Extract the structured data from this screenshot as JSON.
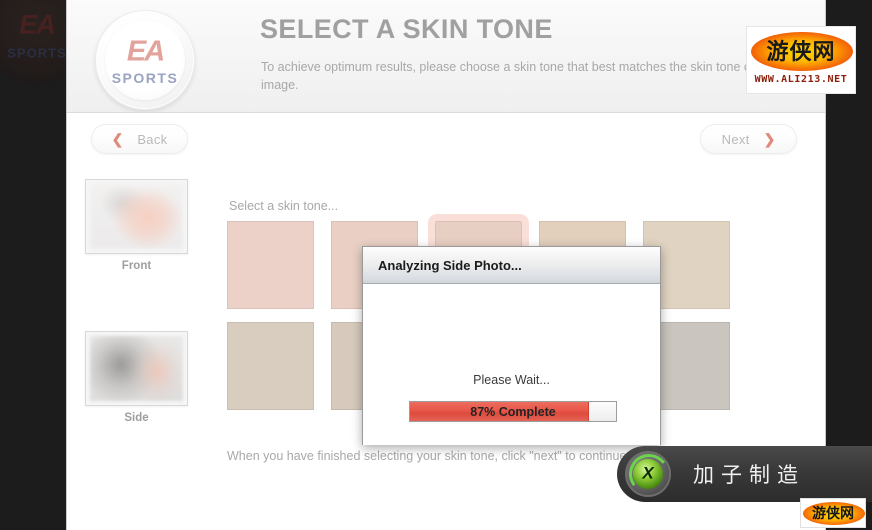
{
  "header": {
    "title": "SELECT A SKIN TONE",
    "subtitle": "To achieve optimum results, please choose a skin tone that best matches the skin tone of your image.",
    "logo": {
      "mark": "EA",
      "wordmark": "SPORTS"
    }
  },
  "nav": {
    "back_label": "Back",
    "back_chevron": "❮",
    "next_label": "Next",
    "next_chevron": "❯"
  },
  "thumbnails": [
    {
      "caption": "Front",
      "view": "front"
    },
    {
      "caption": "Side",
      "view": "side"
    }
  ],
  "swatches": {
    "instruction": "Select a skin tone...",
    "footer_note": "When you have finished selecting your skin tone, click \"next\" to continue.",
    "selected_index": 2,
    "selection_border_color": "#fadfd9",
    "rows": [
      [
        "#ecd1c9",
        "#ead0c4",
        "#e8cfc3",
        "#e2d0bd",
        "#e0d3c1"
      ],
      [
        "#d9cdc0",
        "#d7cabd",
        "#d2c8bd",
        "#ccc6c0",
        "#cac5be"
      ]
    ]
  },
  "dialog": {
    "title": "Analyzing Side Photo...",
    "wait_text": "Please Wait...",
    "progress_label": "87% Complete",
    "progress_percent": 87,
    "progress_color": "#e8584a"
  },
  "watermark_top": {
    "cn_text": "游侠网",
    "url": "WWW.ALI213.NET"
  },
  "overlay_bottom": {
    "label": "加子制造",
    "xbox_mark": "X"
  },
  "watermark_bottom": {
    "cn_text": "游侠网"
  },
  "background_logo": {
    "mark": "EA",
    "wordmark": "SPORTS"
  }
}
